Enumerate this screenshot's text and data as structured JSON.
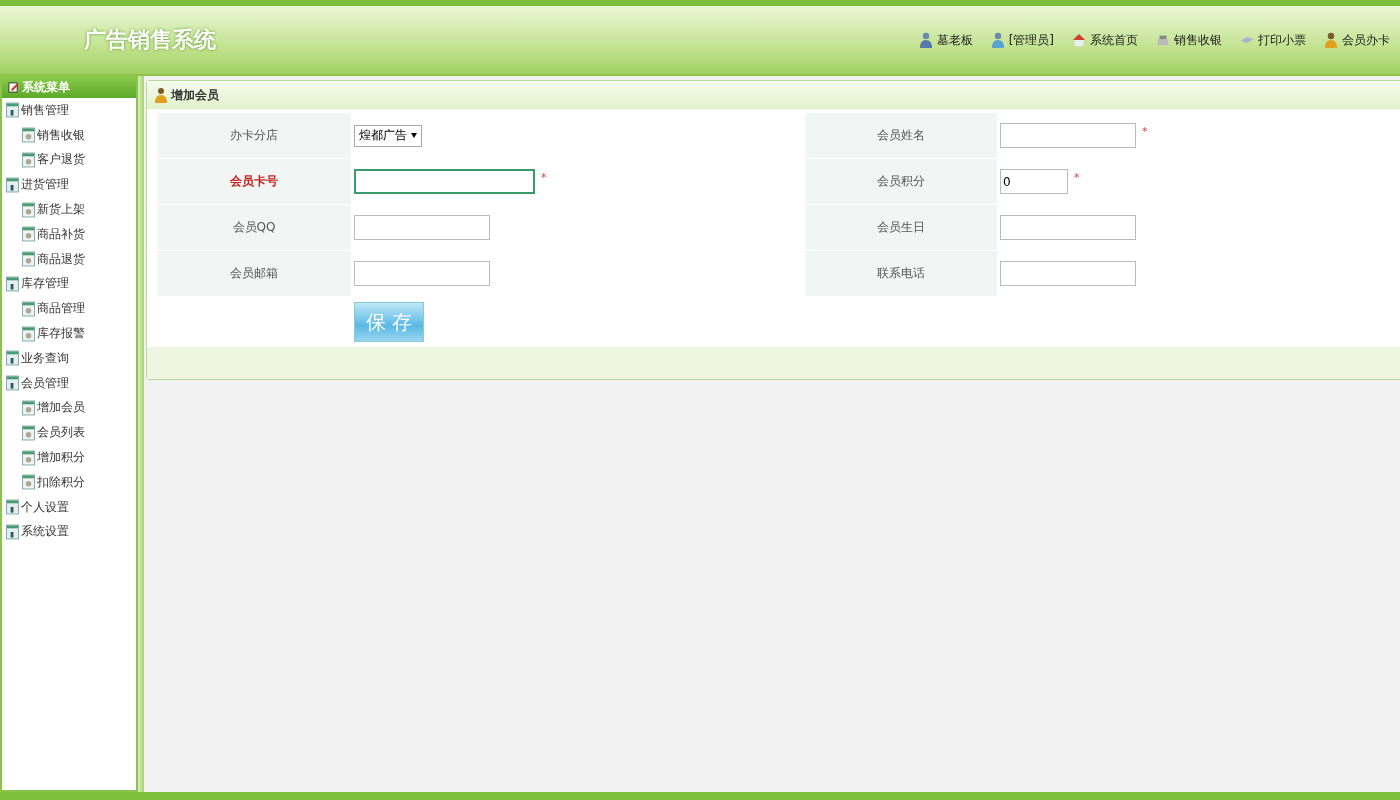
{
  "header": {
    "title": "广告销售系统",
    "nav": [
      {
        "label": "墓老板",
        "kind": "user"
      },
      {
        "label": "[管理员]",
        "kind": "admin"
      },
      {
        "label": "系统首页",
        "kind": "home"
      },
      {
        "label": "销售收银",
        "kind": "cash"
      },
      {
        "label": "打印小票",
        "kind": "print"
      },
      {
        "label": "会员办卡",
        "kind": "member"
      }
    ]
  },
  "sidebar": {
    "title": "系统菜单",
    "items": [
      {
        "label": "销售管理",
        "children": [
          {
            "label": "销售收银"
          },
          {
            "label": "客户退货"
          }
        ]
      },
      {
        "label": "进货管理",
        "children": [
          {
            "label": "新货上架"
          },
          {
            "label": "商品补货"
          },
          {
            "label": "商品退货"
          }
        ]
      },
      {
        "label": "库存管理",
        "children": [
          {
            "label": "商品管理"
          },
          {
            "label": "库存报警"
          }
        ]
      },
      {
        "label": "业务查询"
      },
      {
        "label": "会员管理",
        "children": [
          {
            "label": "增加会员"
          },
          {
            "label": "会员列表"
          },
          {
            "label": "增加积分"
          },
          {
            "label": "扣除积分"
          }
        ]
      },
      {
        "label": "个人设置"
      },
      {
        "label": "系统设置"
      }
    ]
  },
  "form": {
    "title": "增加会员",
    "rows": [
      [
        {
          "label": "办卡分店",
          "kind": "select",
          "value": "煌都广告",
          "focused": false
        },
        {
          "label": "会员姓名",
          "kind": "text",
          "required_mark": "*",
          "focused": false
        }
      ],
      [
        {
          "label": "会员卡号",
          "kind": "wide",
          "required_mark": "*",
          "focused": true
        },
        {
          "label": "会员积分",
          "kind": "short",
          "value": "0",
          "required_mark": "*",
          "focused": false
        }
      ],
      [
        {
          "label": "会员QQ",
          "kind": "text",
          "focused": false
        },
        {
          "label": "会员生日",
          "kind": "text",
          "focused": false
        }
      ],
      [
        {
          "label": "会员邮箱",
          "kind": "text",
          "focused": false
        },
        {
          "label": "联系电话",
          "kind": "text",
          "focused": false
        }
      ]
    ],
    "save_button": "保 存"
  }
}
